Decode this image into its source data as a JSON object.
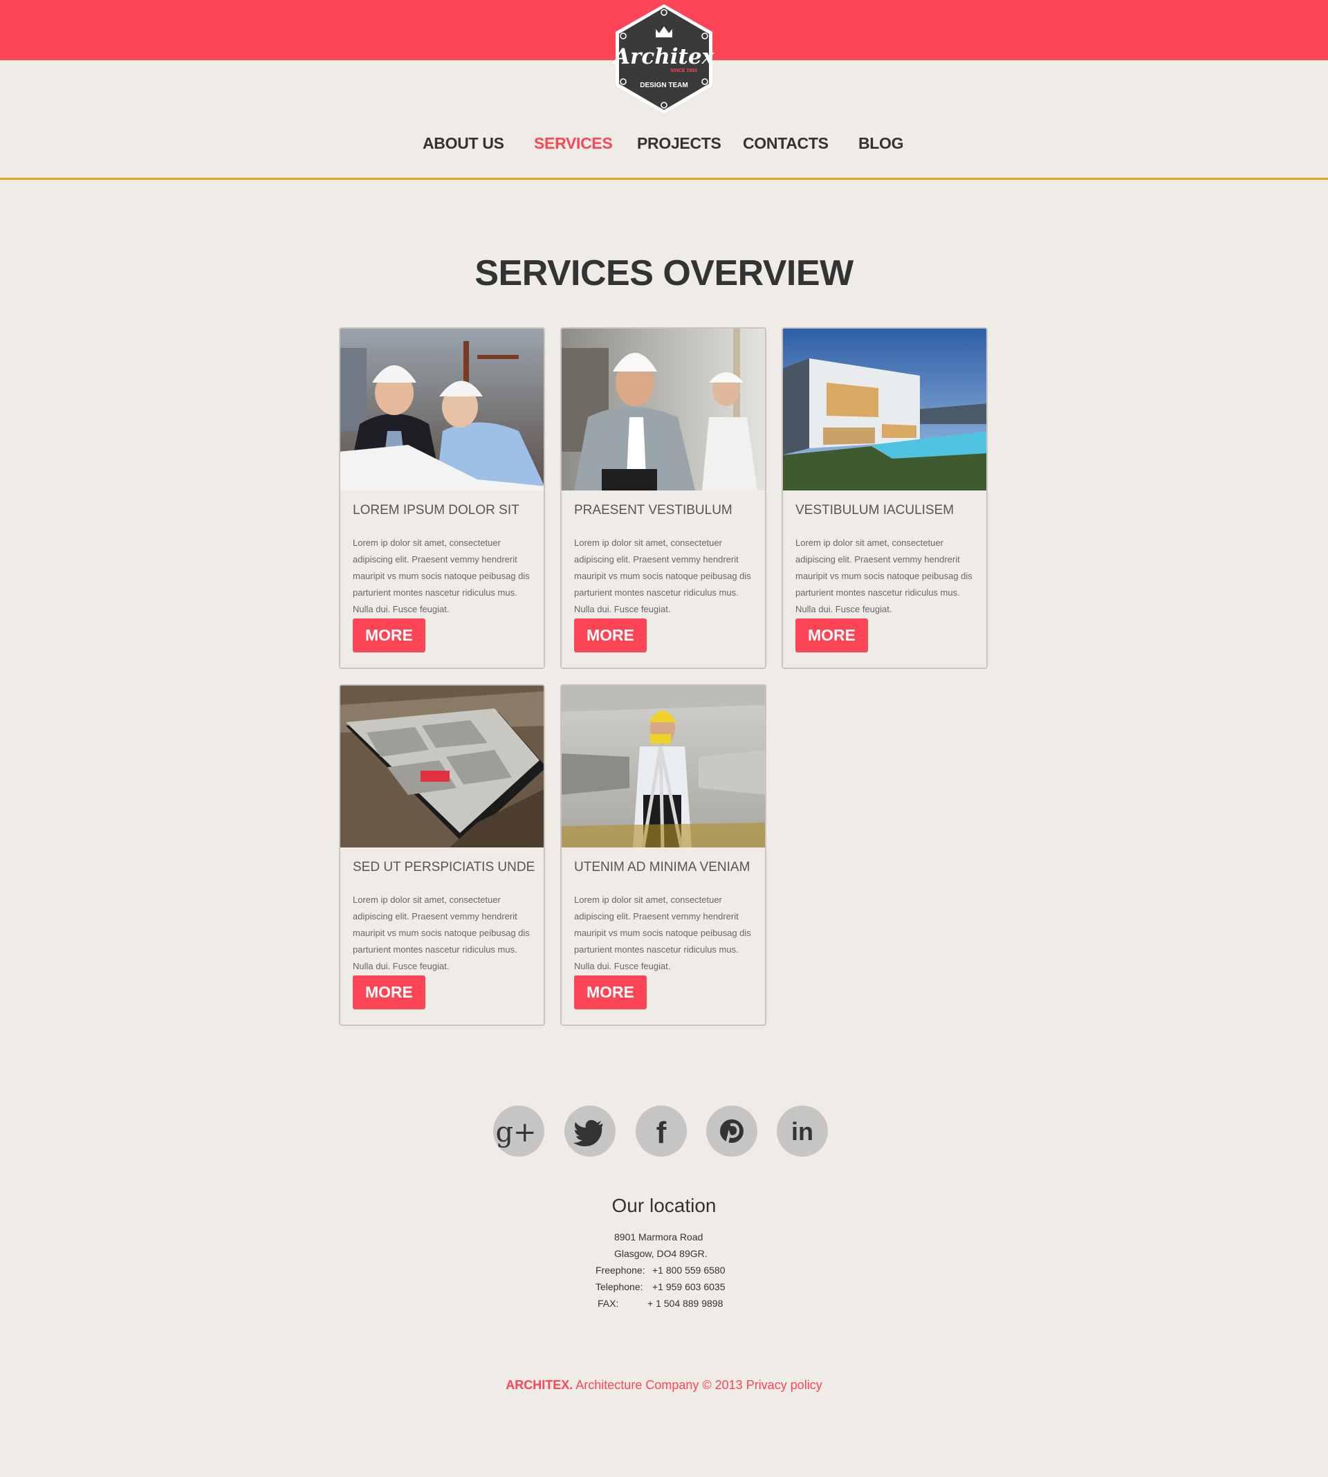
{
  "header": {
    "logo": {
      "name": "Architex",
      "since": "SINCE 1983",
      "tagline": "DESIGN TEAM"
    },
    "nav": [
      {
        "label": "ABOUT US"
      },
      {
        "label": "SERVICES",
        "active": true
      },
      {
        "label": "PROJECTS"
      },
      {
        "label": "CONTACTS"
      },
      {
        "label": "BLOG"
      }
    ]
  },
  "main": {
    "title": "SERVICES OVERVIEW",
    "cards": [
      {
        "title": "LOREM IPSUM DOLOR SIT",
        "text": "Lorem ip dolor sit amet, consectetuer adipiscing elit. Praesent vemmy hendrerit mauripit vs mum socis natoque peibusag dis parturient montes nascetur ridiculus mus. Nulla dui. Fusce feugiat.",
        "button": "MORE",
        "image": "engineers-with-blueprints-photo"
      },
      {
        "title": "PRAESENT VESTIBULUM",
        "text": "Lorem ip dolor sit amet, consectetuer adipiscing elit. Praesent vemmy hendrerit mauripit vs mum socis natoque peibusag dis parturient montes nascetur ridiculus mus. Nulla dui. Fusce feugiat.",
        "button": "MORE",
        "image": "businessman-on-phone-photo"
      },
      {
        "title": "VESTIBULUM IACULISEM",
        "text": "Lorem ip dolor sit amet, consectetuer adipiscing elit. Praesent vemmy hendrerit mauripit vs mum socis natoque peibusag dis parturient montes nascetur ridiculus mus. Nulla dui. Fusce feugiat.",
        "button": "MORE",
        "image": "modern-house-pool-photo"
      },
      {
        "title": "SED UT PERSPICIATIS UNDE",
        "text": "Lorem ip dolor sit amet, consectetuer adipiscing elit. Praesent vemmy hendrerit mauripit vs mum socis natoque peibusag dis parturient montes nascetur ridiculus mus. Nulla dui. Fusce feugiat.",
        "button": "MORE",
        "image": "foundation-construction-photo"
      },
      {
        "title": "UTENIM AD MINIMA VENIAM",
        "text": "Lorem ip dolor sit amet, consectetuer adipiscing elit. Praesent vemmy hendrerit mauripit vs mum socis natoque peibusag dis parturient montes nascetur ridiculus mus. Nulla dui. Fusce feugiat.",
        "button": "MORE",
        "image": "surveyor-with-tripod-photo"
      }
    ]
  },
  "social": [
    {
      "icon": "google-plus-icon",
      "glyph": "g+"
    },
    {
      "icon": "twitter-icon"
    },
    {
      "icon": "facebook-icon",
      "glyph": "f"
    },
    {
      "icon": "pinterest-icon"
    },
    {
      "icon": "linkedin-icon",
      "glyph": "in"
    }
  ],
  "location": {
    "title": "Our location",
    "street": "8901 Marmora Road",
    "city": "Glasgow, DO4 89GR.",
    "freephone_label": "Freephone:",
    "freephone": "+1 800 559 6580",
    "telephone_label": "Telephone:",
    "telephone": "+1 959 603 6035",
    "fax_label": "FAX:",
    "fax": "+ 1 504 889 9898"
  },
  "footer": {
    "brand": "ARCHITEX.",
    "text": " Architecture Company © 2013 ",
    "privacy": "Privacy policy"
  },
  "colors": {
    "accent": "#fd4556",
    "nav_line": "#f2a321",
    "background": "#efece8",
    "text": "#333333"
  }
}
